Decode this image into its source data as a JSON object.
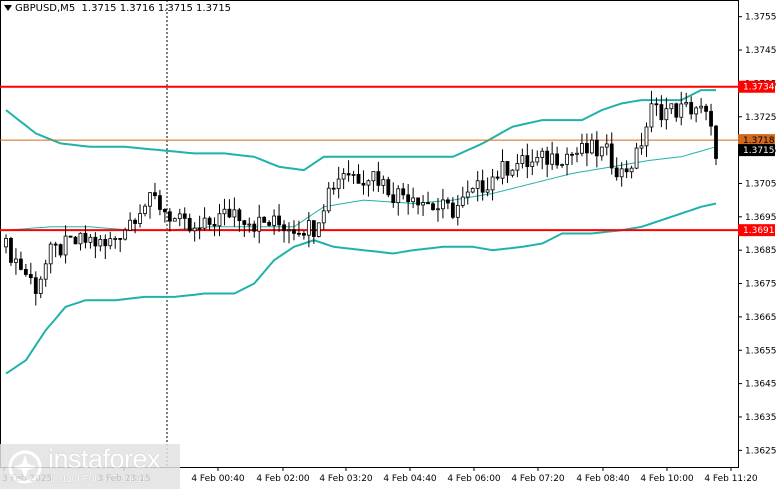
{
  "header": {
    "symbol": "GBPUSD,M5",
    "ohlc": "1.3715 1.3716 1.3715 1.3715"
  },
  "watermark": {
    "brand": "instaforex",
    "tagline": "Instant Forex Trading"
  },
  "colors": {
    "band": "#20b2aa",
    "level_line": "#ff0000",
    "price_line": "#d2691e",
    "candle": "#000000",
    "last_price_tag": "#000000"
  },
  "chart_data": {
    "type": "candlestick",
    "title": "GBPUSD,M5",
    "ylim": [
      1.362,
      1.376
    ],
    "y_ticks": [
      "1.3755",
      "1.3745",
      "1.3735",
      "1.3725",
      "1.3715",
      "1.3705",
      "1.3695",
      "1.3685",
      "1.3675",
      "1.3665",
      "1.3655",
      "1.3645",
      "1.3635",
      "1.3625"
    ],
    "x_tick_labels": [
      "3 Feb 2025",
      "3 Feb 23:15",
      "4 Feb 00:40",
      "4 Feb 02:00",
      "4 Feb 03:20",
      "4 Feb 04:40",
      "4 Feb 06:00",
      "4 Feb 07:20",
      "4 Feb 08:40",
      "4 Feb 10:00",
      "4 Feb 11:20"
    ],
    "levels": [
      {
        "label": "1.3734",
        "value": 1.3734,
        "color": "#ff0000"
      },
      {
        "label": "1.3691",
        "value": 1.3691,
        "color": "#ff0000"
      },
      {
        "label": "1.3718",
        "value": 1.3718,
        "color": "#d2691e"
      }
    ],
    "last_price": {
      "label": "1.3715",
      "value": 1.3715
    },
    "close_path": [
      [
        0,
        1.3686
      ],
      [
        3,
        1.368
      ],
      [
        6,
        1.3674
      ],
      [
        9,
        1.3684
      ],
      [
        13,
        1.3687
      ],
      [
        17,
        1.3688
      ],
      [
        20,
        1.3686
      ],
      [
        24,
        1.3692
      ],
      [
        27,
        1.3698
      ],
      [
        30,
        1.37
      ],
      [
        34,
        1.3694
      ],
      [
        38,
        1.369
      ],
      [
        42,
        1.3694
      ],
      [
        46,
        1.3697
      ],
      [
        50,
        1.3693
      ],
      [
        54,
        1.3693
      ],
      [
        58,
        1.3692
      ],
      [
        62,
        1.3692
      ],
      [
        65,
        1.3703
      ],
      [
        68,
        1.3709
      ],
      [
        71,
        1.3707
      ],
      [
        74,
        1.3708
      ],
      [
        78,
        1.3702
      ],
      [
        82,
        1.3702
      ],
      [
        86,
        1.3698
      ],
      [
        90,
        1.3697
      ],
      [
        94,
        1.3702
      ],
      [
        98,
        1.3707
      ],
      [
        102,
        1.3711
      ],
      [
        106,
        1.3711
      ],
      [
        110,
        1.3713
      ],
      [
        114,
        1.3714
      ],
      [
        118,
        1.3715
      ],
      [
        121,
        1.3714
      ],
      [
        124,
        1.3708
      ],
      [
        127,
        1.3713
      ],
      [
        130,
        1.3727
      ],
      [
        133,
        1.3727
      ],
      [
        136,
        1.3727
      ],
      [
        139,
        1.3728
      ],
      [
        141,
        1.3725
      ],
      [
        143,
        1.3715
      ]
    ],
    "upper_band": [
      [
        0,
        1.3727
      ],
      [
        6,
        1.372
      ],
      [
        11,
        1.3717
      ],
      [
        17,
        1.3716
      ],
      [
        24,
        1.3716
      ],
      [
        31,
        1.3715
      ],
      [
        38,
        1.3714
      ],
      [
        44,
        1.3714
      ],
      [
        50,
        1.3713
      ],
      [
        55,
        1.371
      ],
      [
        60,
        1.3709
      ],
      [
        64,
        1.3713
      ],
      [
        70,
        1.3713
      ],
      [
        78,
        1.3713
      ],
      [
        86,
        1.3713
      ],
      [
        90,
        1.3713
      ],
      [
        96,
        1.3717
      ],
      [
        102,
        1.3722
      ],
      [
        108,
        1.3724
      ],
      [
        116,
        1.3724
      ],
      [
        120,
        1.3727
      ],
      [
        124,
        1.3729
      ],
      [
        128,
        1.373
      ],
      [
        132,
        1.373
      ],
      [
        136,
        1.373
      ],
      [
        140,
        1.3733
      ],
      [
        143,
        1.3733
      ]
    ],
    "middle_band": [
      [
        0,
        1.3691
      ],
      [
        9,
        1.3692
      ],
      [
        17,
        1.3692
      ],
      [
        25,
        1.3691
      ],
      [
        33,
        1.3691
      ],
      [
        41,
        1.3692
      ],
      [
        49,
        1.3692
      ],
      [
        58,
        1.3692
      ],
      [
        64,
        1.3698
      ],
      [
        72,
        1.37
      ],
      [
        82,
        1.3699
      ],
      [
        90,
        1.37
      ],
      [
        98,
        1.3702
      ],
      [
        106,
        1.3705
      ],
      [
        114,
        1.3708
      ],
      [
        122,
        1.371
      ],
      [
        130,
        1.3712
      ],
      [
        136,
        1.3713
      ],
      [
        143,
        1.3716
      ]
    ],
    "lower_band": [
      [
        0,
        1.3648
      ],
      [
        4,
        1.3652
      ],
      [
        8,
        1.3661
      ],
      [
        12,
        1.3668
      ],
      [
        16,
        1.367
      ],
      [
        22,
        1.367
      ],
      [
        28,
        1.3671
      ],
      [
        34,
        1.3671
      ],
      [
        40,
        1.3672
      ],
      [
        46,
        1.3672
      ],
      [
        50,
        1.3675
      ],
      [
        54,
        1.3682
      ],
      [
        58,
        1.3686
      ],
      [
        62,
        1.3688
      ],
      [
        66,
        1.3686
      ],
      [
        72,
        1.3685
      ],
      [
        78,
        1.3684
      ],
      [
        82,
        1.3685
      ],
      [
        88,
        1.3686
      ],
      [
        94,
        1.3686
      ],
      [
        98,
        1.3685
      ],
      [
        104,
        1.3686
      ],
      [
        108,
        1.3687
      ],
      [
        112,
        1.369
      ],
      [
        118,
        1.369
      ],
      [
        124,
        1.3691
      ],
      [
        128,
        1.3692
      ],
      [
        132,
        1.3694
      ],
      [
        136,
        1.3696
      ],
      [
        140,
        1.3698
      ],
      [
        143,
        1.3699
      ]
    ]
  }
}
